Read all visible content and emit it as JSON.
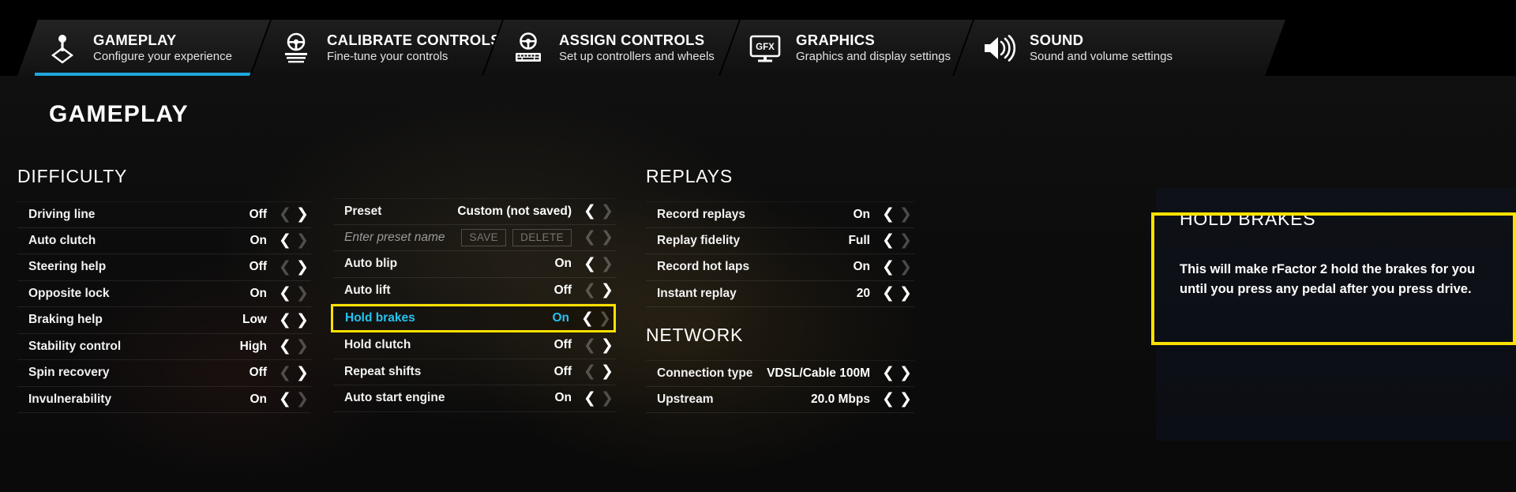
{
  "tabs": [
    {
      "icon": "gear-shifter-icon",
      "title": "GAMEPLAY",
      "subtitle": "Configure your experience",
      "active": true
    },
    {
      "icon": "steering-wheel-pedals-icon",
      "title": "CALIBRATE CONTROLS",
      "subtitle": "Fine-tune your controls",
      "active": false
    },
    {
      "icon": "steering-wheel-keyboard-icon",
      "title": "ASSIGN CONTROLS",
      "subtitle": "Set up controllers and wheels",
      "active": false
    },
    {
      "icon": "gfx-monitor-icon",
      "title": "GRAPHICS",
      "subtitle": "Graphics and display settings",
      "active": false
    },
    {
      "icon": "speaker-volume-icon",
      "title": "SOUND",
      "subtitle": "Sound and volume settings",
      "active": false
    }
  ],
  "page": {
    "title": "GAMEPLAY"
  },
  "accent": {
    "tab_underline": "#1ea7de",
    "highlight": "#ffe100",
    "selected_text": "#23c4f0"
  },
  "difficulty": {
    "heading": "DIFFICULTY",
    "rows": [
      {
        "label": "Driving line",
        "value": "Off",
        "left_enabled": false,
        "right_enabled": true
      },
      {
        "label": "Auto clutch",
        "value": "On",
        "left_enabled": true,
        "right_enabled": false
      },
      {
        "label": "Steering help",
        "value": "Off",
        "left_enabled": false,
        "right_enabled": true
      },
      {
        "label": "Opposite lock",
        "value": "On",
        "left_enabled": true,
        "right_enabled": false
      },
      {
        "label": "Braking help",
        "value": "Low",
        "left_enabled": true,
        "right_enabled": true
      },
      {
        "label": "Stability control",
        "value": "High",
        "left_enabled": true,
        "right_enabled": false
      },
      {
        "label": "Spin recovery",
        "value": "Off",
        "left_enabled": false,
        "right_enabled": true
      },
      {
        "label": "Invulnerability",
        "value": "On",
        "left_enabled": true,
        "right_enabled": false
      }
    ]
  },
  "assists": {
    "preset_label": "Preset",
    "preset_value": "Custom (not saved)",
    "preset_name_placeholder": "Enter preset name",
    "preset_name_value": "",
    "save_label": "SAVE",
    "delete_label": "DELETE",
    "rows": [
      {
        "label": "Auto blip",
        "value": "On",
        "left_enabled": true,
        "right_enabled": false,
        "highlighted": false
      },
      {
        "label": "Auto lift",
        "value": "Off",
        "left_enabled": false,
        "right_enabled": true,
        "highlighted": false
      },
      {
        "label": "Hold brakes",
        "value": "On",
        "left_enabled": true,
        "right_enabled": false,
        "highlighted": true
      },
      {
        "label": "Hold clutch",
        "value": "Off",
        "left_enabled": false,
        "right_enabled": true,
        "highlighted": false
      },
      {
        "label": "Repeat shifts",
        "value": "Off",
        "left_enabled": false,
        "right_enabled": true,
        "highlighted": false
      },
      {
        "label": "Auto start engine",
        "value": "On",
        "left_enabled": true,
        "right_enabled": false,
        "highlighted": false
      }
    ]
  },
  "replays": {
    "heading": "REPLAYS",
    "rows": [
      {
        "label": "Record replays",
        "value": "On",
        "left_enabled": true,
        "right_enabled": false
      },
      {
        "label": "Replay fidelity",
        "value": "Full",
        "left_enabled": true,
        "right_enabled": false
      },
      {
        "label": "Record hot laps",
        "value": "On",
        "left_enabled": true,
        "right_enabled": false
      },
      {
        "label": "Instant replay",
        "value": "20",
        "left_enabled": true,
        "right_enabled": true
      }
    ]
  },
  "network": {
    "heading": "NETWORK",
    "rows": [
      {
        "label": "Connection type",
        "value": "VDSL/Cable 100M",
        "left_enabled": true,
        "right_enabled": true
      },
      {
        "label": "Upstream",
        "value": "20.0 Mbps",
        "left_enabled": true,
        "right_enabled": true
      }
    ]
  },
  "tooltip": {
    "title": "HOLD BRAKES",
    "body": "This will make rFactor 2 hold the brakes for you until you press any pedal after you press drive."
  },
  "glyphs": {
    "left_arrow": "❮",
    "right_arrow": "❯"
  }
}
